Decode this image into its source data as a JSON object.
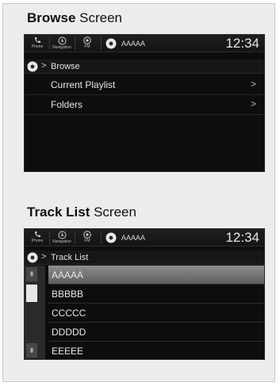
{
  "sections": [
    {
      "title_bold": "Browse",
      "title_rest": " Screen",
      "status_bar": {
        "buttons": [
          {
            "label": "Phone",
            "icon": "phone-icon"
          },
          {
            "label": "Navigation",
            "icon": "navigation-icon"
          },
          {
            "label": "FM",
            "icon": "fm-icon"
          }
        ],
        "source_icon": "disc-icon",
        "source_text": "AAAAA",
        "clock": "12:34"
      },
      "breadcrumb": {
        "icon": "disc-icon",
        "separator": ">",
        "text": "Browse"
      },
      "items": [
        {
          "label": "Current Playlist",
          "arrow": ">"
        },
        {
          "label": "Folders",
          "arrow": ">"
        }
      ]
    },
    {
      "title_bold": "Track List",
      "title_rest": " Screen",
      "status_bar": {
        "buttons": [
          {
            "label": "Phone",
            "icon": "phone-icon"
          },
          {
            "label": "Navigation",
            "icon": "navigation-icon"
          },
          {
            "label": "FM",
            "icon": "fm-icon"
          }
        ],
        "source_icon": "disc-icon",
        "source_text": "AAAAA",
        "clock": "12:34"
      },
      "breadcrumb": {
        "icon": "disc-icon",
        "separator": ">",
        "text": "Track List"
      },
      "tracks": [
        {
          "label": "AAAAA",
          "selected": true
        },
        {
          "label": "BBBBB",
          "selected": false
        },
        {
          "label": "CCCCC",
          "selected": false
        },
        {
          "label": "DDDDD",
          "selected": false
        },
        {
          "label": "EEEEE",
          "selected": false
        }
      ],
      "scroll": {
        "up_icon": "scroll-up-icon",
        "down_icon": "scroll-down-icon"
      }
    }
  ],
  "colors": {
    "screen_bg": "#0d0d0d",
    "selected_row": "#7a7a7a",
    "text": "#e6e6e6"
  }
}
